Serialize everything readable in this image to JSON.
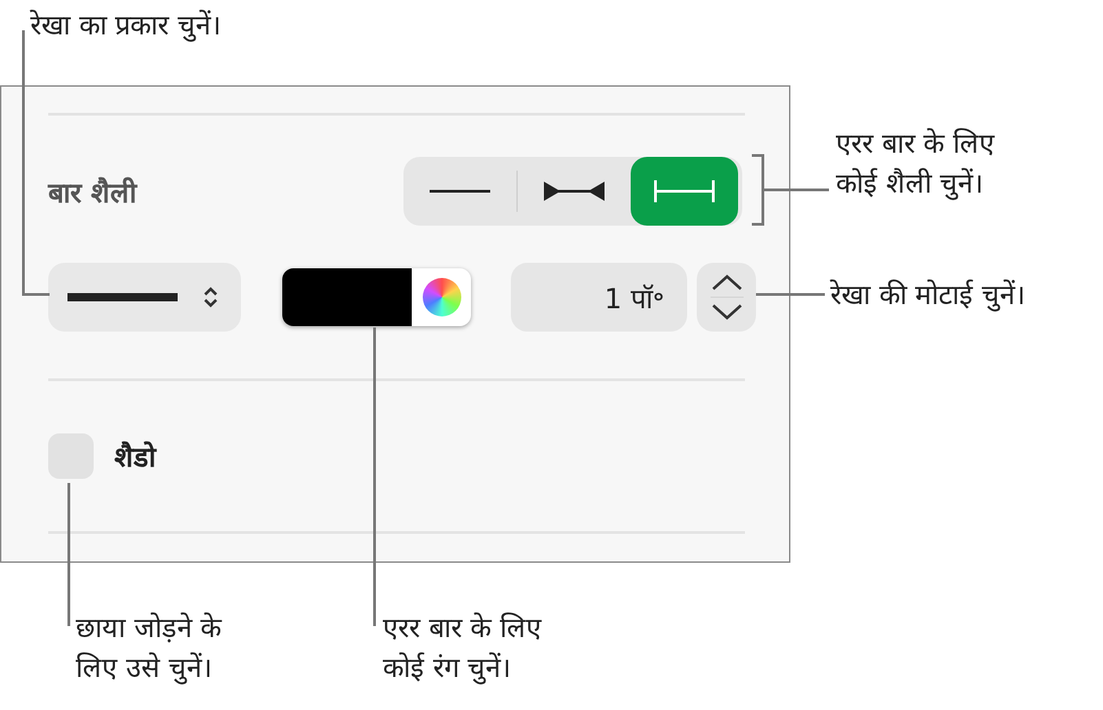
{
  "panel": {
    "bar_style": {
      "label": "बार शैली",
      "options": [
        {
          "kind": "plain",
          "selected": false
        },
        {
          "kind": "inward",
          "selected": false
        },
        {
          "kind": "capped",
          "selected": true
        }
      ]
    },
    "color_well": {
      "color": "#000000"
    },
    "thickness": {
      "value": "1 पॉ॰"
    },
    "shadow": {
      "label": "शैडो",
      "checked": false
    }
  },
  "callouts": [
    {
      "lines": [
        "रेखा का प्रकार चुनें।"
      ]
    },
    {
      "lines": [
        "एरर बार के लिए",
        "कोई शैली चुनें।"
      ]
    },
    {
      "lines": [
        "रेखा की मोटाई चुनें।"
      ]
    },
    {
      "lines": [
        "छाया जोड़ने के",
        "लिए उसे चुनें।"
      ]
    },
    {
      "lines": [
        "एरर बार के लिए",
        "कोई रंग चुनें।"
      ]
    }
  ]
}
